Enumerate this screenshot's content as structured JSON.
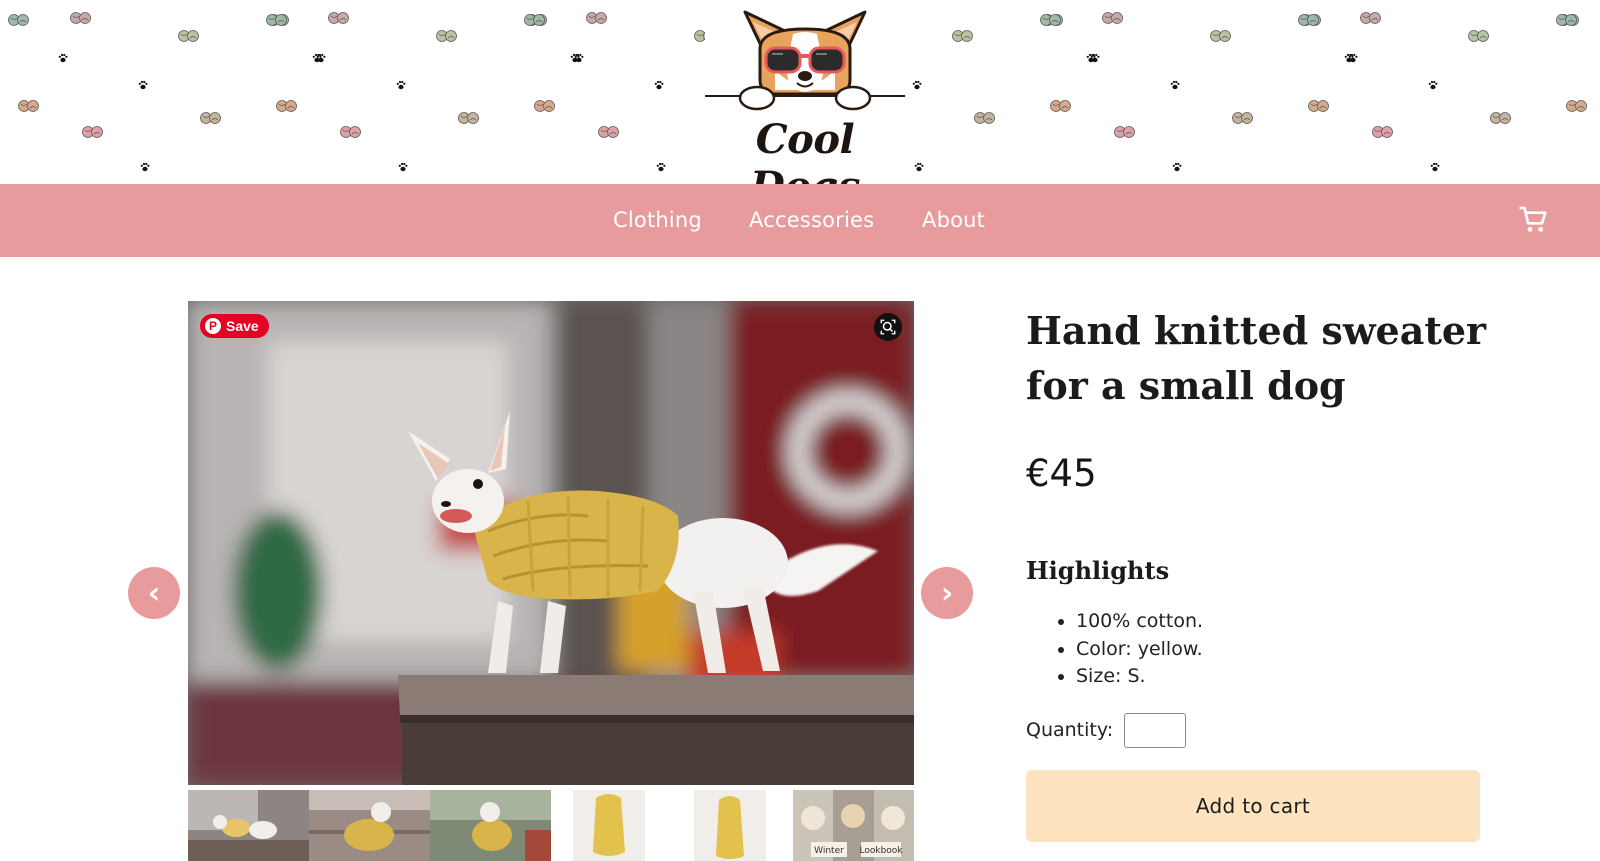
{
  "brand": {
    "name": "Cool Dogs"
  },
  "nav": {
    "items": [
      {
        "label": "Clothing"
      },
      {
        "label": "Accessories"
      },
      {
        "label": "About"
      }
    ],
    "cart_icon": "shopping-cart-icon",
    "bg_color": "#e89b9c"
  },
  "gallery": {
    "save_label": "Save",
    "zoom_icon": "zoom-icon",
    "prev_label": "‹",
    "next_label": "›",
    "thumbnail_text": [
      "Winter",
      "Lookbook"
    ]
  },
  "product": {
    "title": "Hand knitted sweater for a small dog",
    "price": "€45",
    "highlights_heading": "Highlights",
    "highlights": [
      "100% cotton.",
      "Color: yellow.",
      "Size: S."
    ],
    "quantity_label": "Quantity:",
    "quantity_value": "",
    "add_to_cart_label": "Add to cart"
  },
  "colors": {
    "accent": "#e89b9c",
    "button": "#fde3bf",
    "pinterest": "#e60023"
  }
}
